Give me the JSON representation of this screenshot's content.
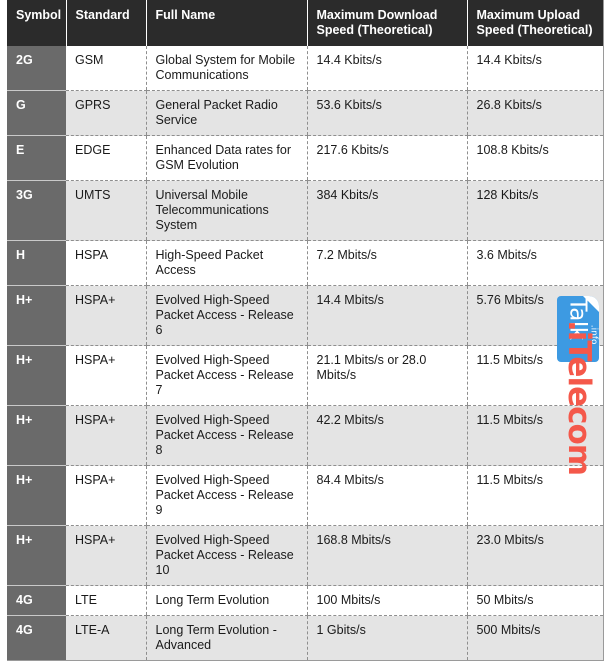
{
  "table": {
    "columns": [
      {
        "key": "symbol",
        "label": "Symbol"
      },
      {
        "key": "standard",
        "label": "Standard"
      },
      {
        "key": "fullname",
        "label": "Full Name"
      },
      {
        "key": "download",
        "label": "Maximum Download Speed (Theoretical)"
      },
      {
        "key": "upload",
        "label": "Maximum Upload Speed (Theoretical)"
      }
    ],
    "header": {
      "symbol": "Symbol",
      "standard": "Standard",
      "fullname": "Full Name",
      "download_line1": "Maximum Download",
      "download_line2": "Speed (Theoretical)",
      "upload_line1": "Maximum Upload",
      "upload_line2": "Speed (Theoretical)"
    },
    "rows": [
      {
        "symbol": "2G",
        "standard": "GSM",
        "fullname": "Global System for Mobile Communications",
        "download": "14.4 Kbits/s",
        "upload": "14.4 Kbits/s"
      },
      {
        "symbol": "G",
        "standard": "GPRS",
        "fullname": "General Packet Radio Service",
        "download": "53.6 Kbits/s",
        "upload": "26.8 Kbits/s"
      },
      {
        "symbol": "E",
        "standard": "EDGE",
        "fullname": "Enhanced Data rates for GSM Evolution",
        "download": "217.6 Kbits/s",
        "upload": "108.8 Kbits/s"
      },
      {
        "symbol": "3G",
        "standard": "UMTS",
        "fullname": "Universal Mobile Telecommunications System",
        "download": "384 Kbits/s",
        "upload": "128 Kbits/s"
      },
      {
        "symbol": "H",
        "standard": "HSPA",
        "fullname": "High-Speed Packet Access",
        "download": "7.2 Mbits/s",
        "upload": "3.6 Mbits/s"
      },
      {
        "symbol": "H+",
        "standard": "HSPA+",
        "fullname": "Evolved High-Speed Packet Access - Release 6",
        "download": "14.4 Mbits/s",
        "upload": "5.76 Mbits/s"
      },
      {
        "symbol": "H+",
        "standard": "HSPA+",
        "fullname": "Evolved High-Speed Packet Access - Release 7",
        "download": "21.1 Mbits/s or 28.0 Mbits/s",
        "upload": "11.5 Mbits/s"
      },
      {
        "symbol": "H+",
        "standard": "HSPA+",
        "fullname": "Evolved High-Speed Packet Access - Release 8",
        "download": "42.2 Mbits/s",
        "upload": "11.5 Mbits/s"
      },
      {
        "symbol": "H+",
        "standard": "HSPA+",
        "fullname": "Evolved High-Speed Packet Access - Release 9",
        "download": "84.4 Mbits/s",
        "upload": "11.5 Mbits/s"
      },
      {
        "symbol": "H+",
        "standard": "HSPA+",
        "fullname": "Evolved High-Speed Packet Access - Release 10",
        "download": "168.8 Mbits/s",
        "upload": "23.0 Mbits/s"
      },
      {
        "symbol": "4G",
        "standard": "LTE",
        "fullname": "Long Term Evolution",
        "download": "100 Mbits/s",
        "upload": "50 Mbits/s"
      },
      {
        "symbol": "4G",
        "standard": "LTE-A",
        "fullname": "Long Term Evolution - Advanced",
        "download": "1 Gbits/s",
        "upload": "500 Mbits/s"
      }
    ]
  },
  "watermark": {
    "badge_text": "Talk",
    "tld_text": ".info",
    "brand_text": ".iTelecom",
    "badge_color": "#3d9ae2",
    "brand_color": "#f4584a"
  },
  "colors": {
    "header_bg": "#2b2b2b",
    "header_text": "#ffffff",
    "symbol_col_bg": "#6a6a6a",
    "row_bg": "#ffffff",
    "row_alt_bg": "#e4e4e4",
    "body_text": "#1a1a1a",
    "grid_dash": "#8e8e8e",
    "outer_border": "#9a9a9a"
  }
}
